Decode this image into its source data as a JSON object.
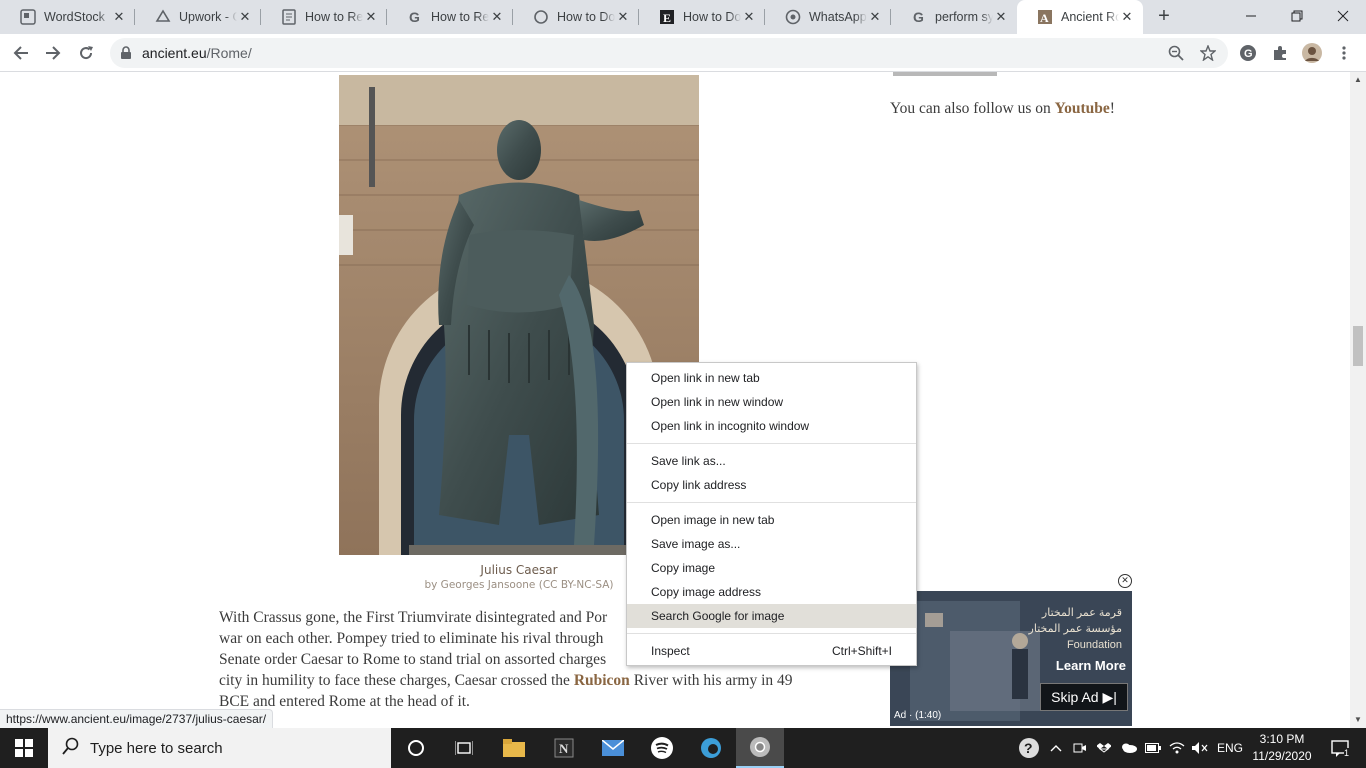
{
  "browser": {
    "tabs": [
      {
        "title": "WordStock",
        "icon": "wordstock-icon"
      },
      {
        "title": "Upwork - G",
        "icon": "drive-icon"
      },
      {
        "title": "How to Rev",
        "icon": "docs-icon"
      },
      {
        "title": "How to Rev",
        "icon": "google-icon"
      },
      {
        "title": "How to Do",
        "icon": "circle-icon"
      },
      {
        "title": "How to Do",
        "icon": "e-icon"
      },
      {
        "title": "WhatsApp",
        "icon": "whatsapp-icon"
      },
      {
        "title": "perform sy",
        "icon": "google-icon"
      },
      {
        "title": "Ancient Ror",
        "icon": "ancient-icon"
      }
    ],
    "active_tab": 8,
    "url_host": "ancient.eu",
    "url_path": "/Rome/",
    "status_url": "https://www.ancient.eu/image/2737/julius-caesar/"
  },
  "page": {
    "follow_text": "You can also follow us on ",
    "follow_link": "Youtube",
    "follow_end": "!",
    "caption_title": "Julius Caesar",
    "caption_credit": "by Georges Jansoone (CC BY-NC-SA)",
    "paragraph": {
      "line1": "With Crassus gone, the First Triumvirate disintegrated and Por",
      "line2": "war on each other. Pompey tried to eliminate his rival through",
      "line3": "Senate order Caesar to Rome to stand trial on assorted charges",
      "line4_pre": "city in humility to face these charges, Caesar crossed the ",
      "line4_link": "Rubicon",
      "line4_post": " River with his army in 49",
      "line5": "BCE and entered Rome at the head of it."
    }
  },
  "context_menu": {
    "group1": [
      "Open link in new tab",
      "Open link in new window",
      "Open link in incognito window"
    ],
    "group2": [
      "Save link as...",
      "Copy link address"
    ],
    "group3": [
      "Open image in new tab",
      "Save image as...",
      "Copy image",
      "Copy image address",
      "Search Google for image"
    ],
    "inspect": "Inspect",
    "inspect_shortcut": "Ctrl+Shift+I",
    "hovered": "Search Google for image"
  },
  "ad": {
    "arabic_line1": "قرمة عمر المختار",
    "arabic_line2": "مؤسسة عمر المختار",
    "foundation": "Foundation",
    "learn_more": "Learn More",
    "skip": "Skip Ad",
    "ad_time": "Ad · (1:40)"
  },
  "taskbar": {
    "search_placeholder": "Type here to search",
    "language": "ENG",
    "time": "3:10 PM",
    "date": "11/29/2020",
    "notification_count": "1"
  },
  "colors": {
    "link": "#8a6642",
    "menu_hover": "#e1dfd9",
    "taskbar": "#1f1f1f"
  }
}
